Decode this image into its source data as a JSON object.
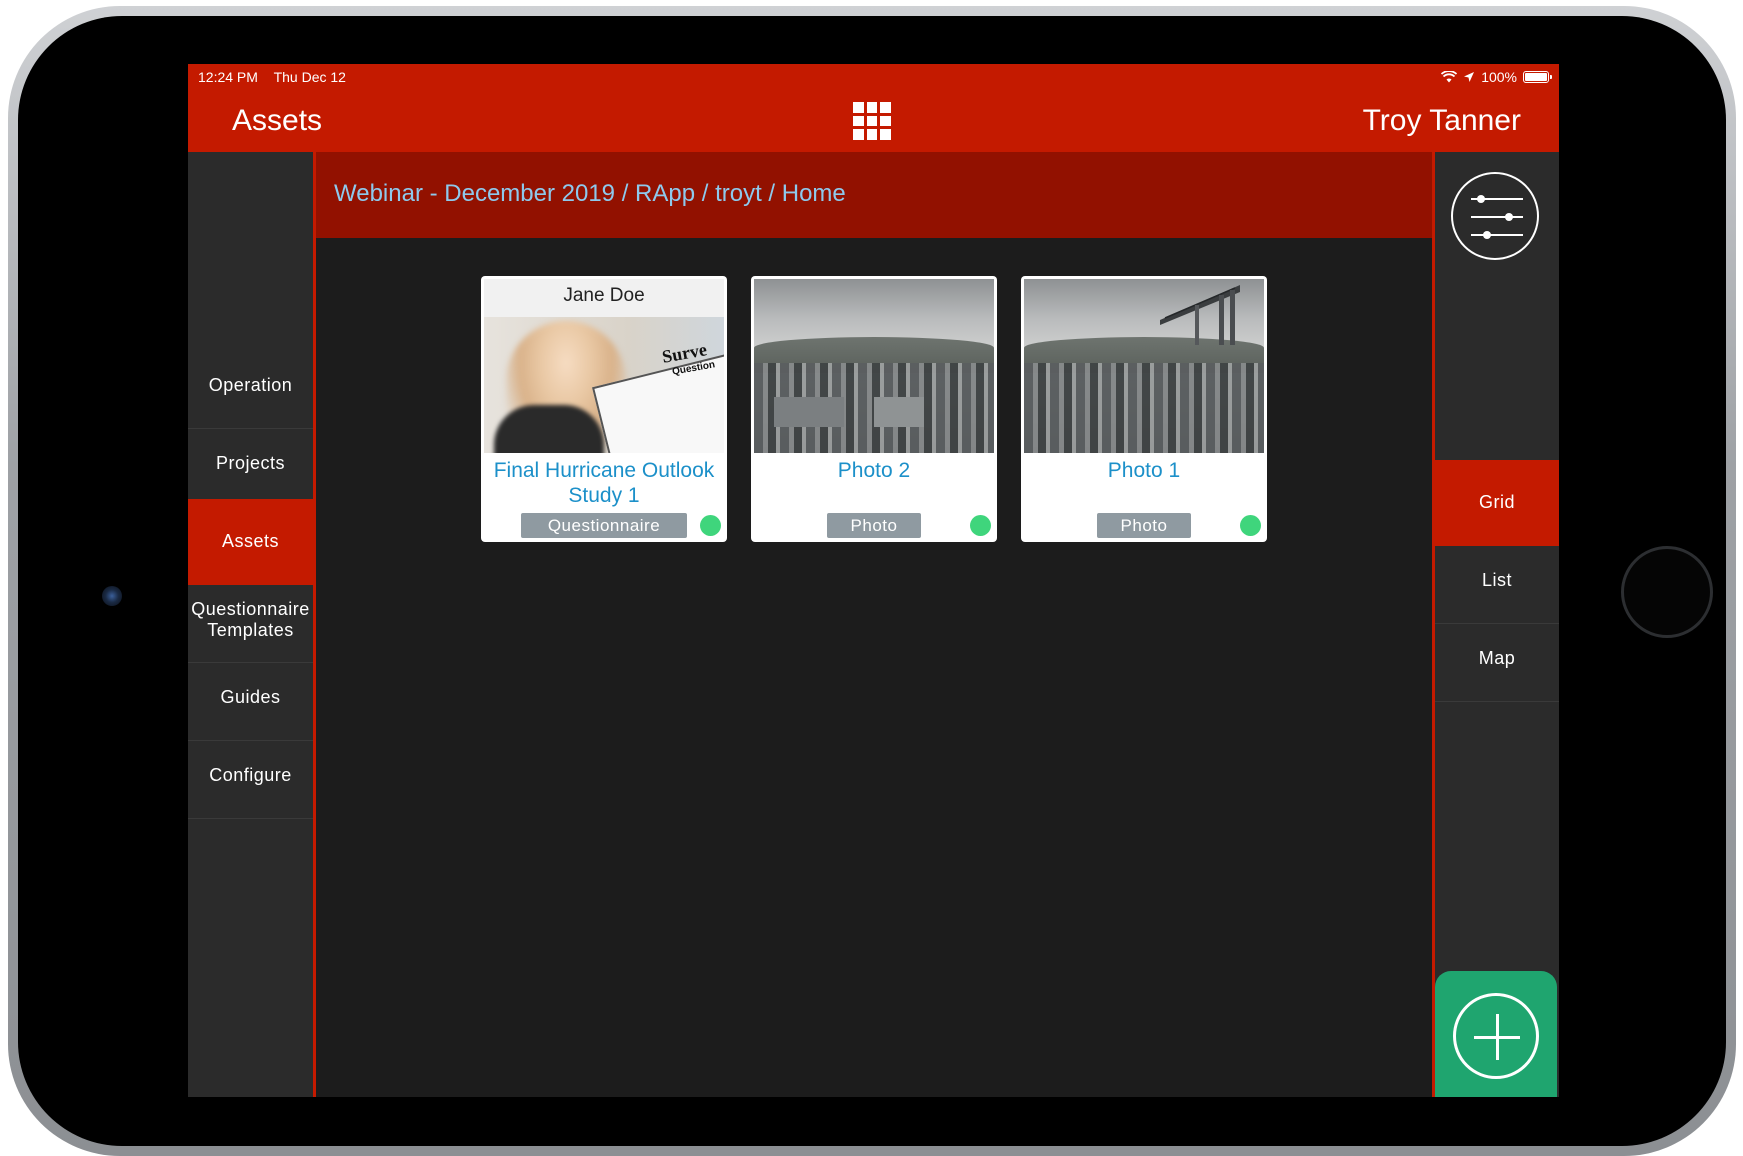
{
  "status_bar": {
    "time": "12:24 PM",
    "date": "Thu Dec 12",
    "battery": "100%"
  },
  "nav": {
    "title": "Assets",
    "user": "Troy Tanner",
    "center_icon": "grid-apps-icon"
  },
  "breadcrumb": "Webinar - December 2019 / RApp / troyt / Home",
  "left_sidebar": {
    "items": [
      {
        "label": "Operation",
        "active": false
      },
      {
        "label": "Projects",
        "active": false
      },
      {
        "label": "Assets",
        "active": true
      },
      {
        "label": "Questionnaire Templates",
        "active": false
      },
      {
        "label": "Guides",
        "active": false
      },
      {
        "label": "Configure",
        "active": false
      }
    ]
  },
  "right_sidebar": {
    "filter_icon": "filter-sliders-icon",
    "views": [
      {
        "label": "Grid",
        "active": true
      },
      {
        "label": "List",
        "active": false
      },
      {
        "label": "Map",
        "active": false
      }
    ],
    "add_icon": "add-plus-icon"
  },
  "cards": [
    {
      "image_label": "Jane Doe",
      "clipboard_text": "Surve",
      "clipboard_sub": "Question",
      "title": "Final Hurricane Outlook Study 1",
      "badge": "Questionnaire",
      "status_color": "#3fd57c"
    },
    {
      "title": "Photo 2",
      "badge": "Photo",
      "status_color": "#3fd57c"
    },
    {
      "title": "Photo 1",
      "badge": "Photo",
      "status_color": "#3fd57c"
    }
  ],
  "colors": {
    "accent_red": "#c41a00",
    "breadcrumb_bg": "#921100",
    "link_blue": "#1c90c9",
    "add_green": "#1fa56f"
  }
}
